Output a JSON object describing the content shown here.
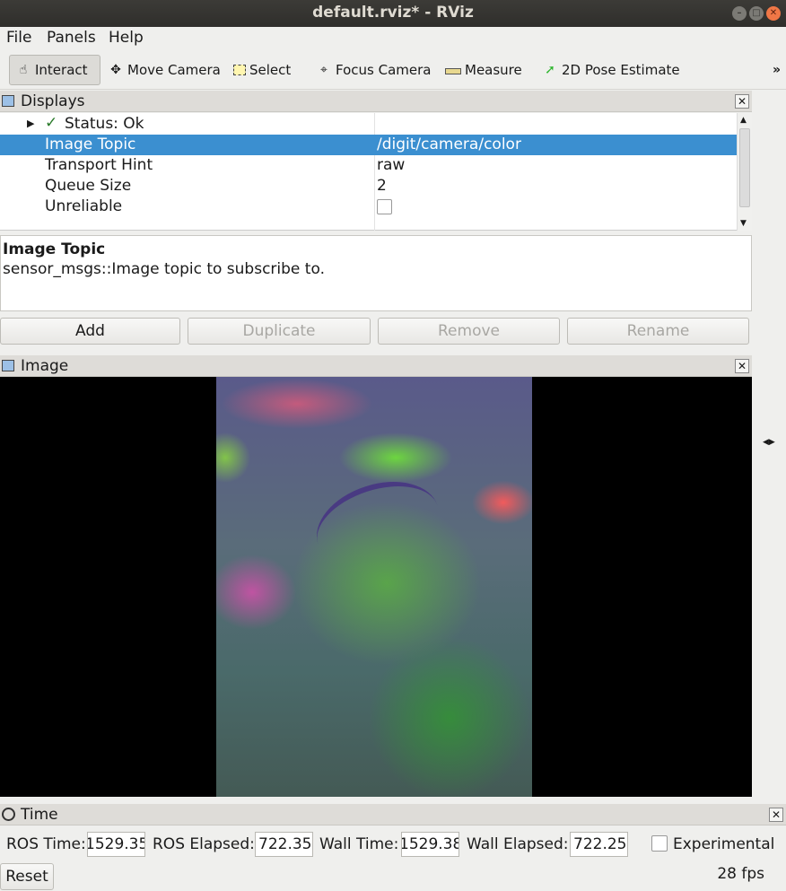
{
  "window": {
    "title": "default.rviz* - RViz"
  },
  "menu": {
    "file": "File",
    "panels": "Panels",
    "help": "Help"
  },
  "toolbar": {
    "interact": "Interact",
    "move_camera": "Move Camera",
    "select": "Select",
    "focus_camera": "Focus Camera",
    "measure": "Measure",
    "pose_estimate": "2D Pose Estimate",
    "more": "»"
  },
  "displays": {
    "title": "Displays",
    "status": "Status: Ok",
    "rows": [
      {
        "key": "Image Topic",
        "value": "/digit/camera/color"
      },
      {
        "key": "Transport Hint",
        "value": "raw"
      },
      {
        "key": "Queue Size",
        "value": "2"
      },
      {
        "key": "Unreliable",
        "value": ""
      }
    ]
  },
  "description": {
    "title": "Image Topic",
    "text": "sensor_msgs::Image topic to subscribe to."
  },
  "buttons": {
    "add": "Add",
    "duplicate": "Duplicate",
    "remove": "Remove",
    "rename": "Rename"
  },
  "image_panel": {
    "title": "Image"
  },
  "time": {
    "title": "Time",
    "ros_time_label": "ROS Time:",
    "ros_time": "1529.35",
    "ros_elapsed_label": "ROS Elapsed:",
    "ros_elapsed": "722.35",
    "wall_time_label": "Wall Time:",
    "wall_time": "1529.38",
    "wall_elapsed_label": "Wall Elapsed:",
    "wall_elapsed": "722.25",
    "experimental": "Experimental",
    "reset": "Reset",
    "fps": "28 fps"
  }
}
